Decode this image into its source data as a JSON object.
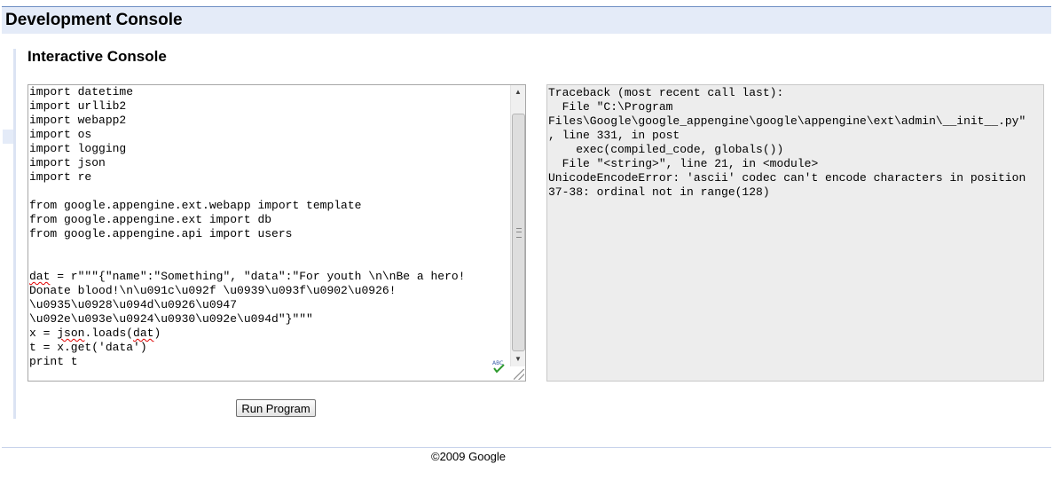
{
  "header": {
    "title": "Development Console"
  },
  "section": {
    "title": "Interactive Console"
  },
  "editor": {
    "lines": [
      "import datetime",
      "import urllib2",
      "import webapp2",
      "import os",
      "import logging",
      "import json",
      "import re",
      "",
      "from google.appengine.ext.webapp import template",
      "from google.appengine.ext import db",
      "from google.appengine.api import users",
      "",
      "",
      "dat = r\"\"\"{\"name\":\"Something\", \"data\":\"For youth \\n\\nBe a hero!",
      "Donate blood!\\n\\u091c\\u092f \\u0939\\u093f\\u0902\\u0926!",
      "\\u0935\\u0928\\u094d\\u0926\\u0947",
      "\\u092e\\u093e\\u0924\\u0930\\u092e\\u094d\"}\"\"\"",
      "x = json.loads(dat)",
      "t = x.get('data')",
      "print t"
    ],
    "misspelled": [
      "dat",
      "json",
      "dat"
    ],
    "spellcheck_icon": "spellcheck-icon"
  },
  "output": {
    "lines": [
      "Traceback (most recent call last):",
      "  File \"C:\\Program",
      "Files\\Google\\google_appengine\\google\\appengine\\ext\\admin\\__init__.py\"",
      ", line 331, in post",
      "    exec(compiled_code, globals())",
      "  File \"<string>\", line 21, in <module>",
      "UnicodeEncodeError: 'ascii' codec can't encode characters in position",
      "37-38: ordinal not in range(128)"
    ]
  },
  "run_button": {
    "label": "Run Program"
  },
  "footer": {
    "copyright": "©2009 Google"
  },
  "colors": {
    "header_bg": "#e4ebf8",
    "header_rule": "#6f8fc4",
    "output_bg": "#ededed",
    "misspell_underline": "#e00000"
  }
}
